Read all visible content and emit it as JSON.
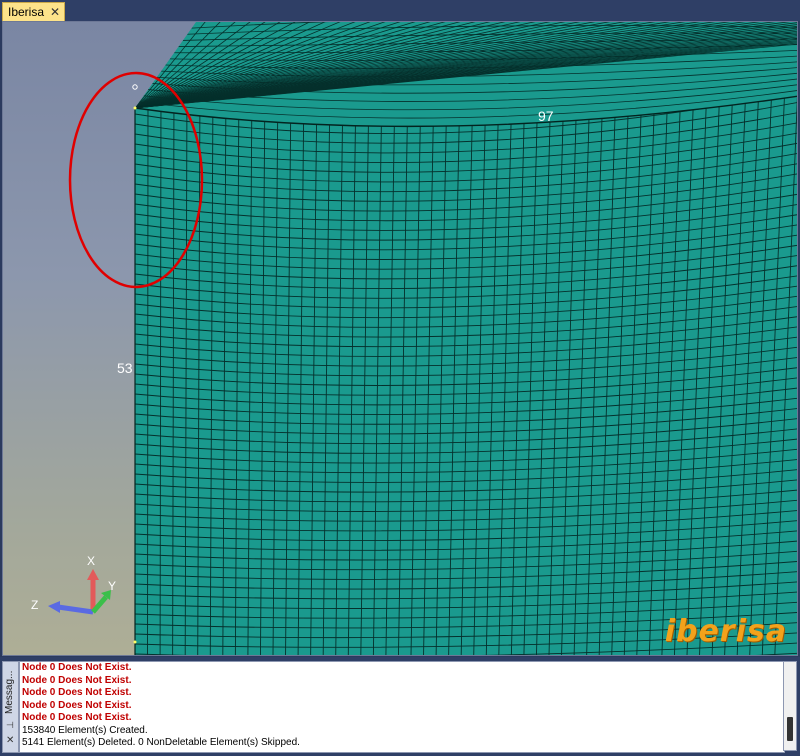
{
  "tab": {
    "label": "Iberisa",
    "close_glyph": "✕"
  },
  "viewport": {
    "dim_top": "97",
    "dim_left": "53",
    "logo_text": "iberisa",
    "mesh_color": "#1a9a8e",
    "annotation_color": "#e00000",
    "axis": {
      "x": "X",
      "y": "Y",
      "z": "Z"
    }
  },
  "messages": {
    "panel_title": "Messag...",
    "lines": [
      {
        "text": "Node 0 Does Not Exist.",
        "type": "error"
      },
      {
        "text": "Node 0 Does Not Exist.",
        "type": "error"
      },
      {
        "text": "Node 0 Does Not Exist.",
        "type": "error"
      },
      {
        "text": "Node 0 Does Not Exist.",
        "type": "error"
      },
      {
        "text": "Node 0 Does Not Exist.",
        "type": "error"
      },
      {
        "text": "153840 Element(s) Created.",
        "type": "info"
      },
      {
        "text": "5141 Element(s) Deleted. 0 NonDeletable Element(s) Skipped.",
        "type": "info"
      }
    ]
  }
}
